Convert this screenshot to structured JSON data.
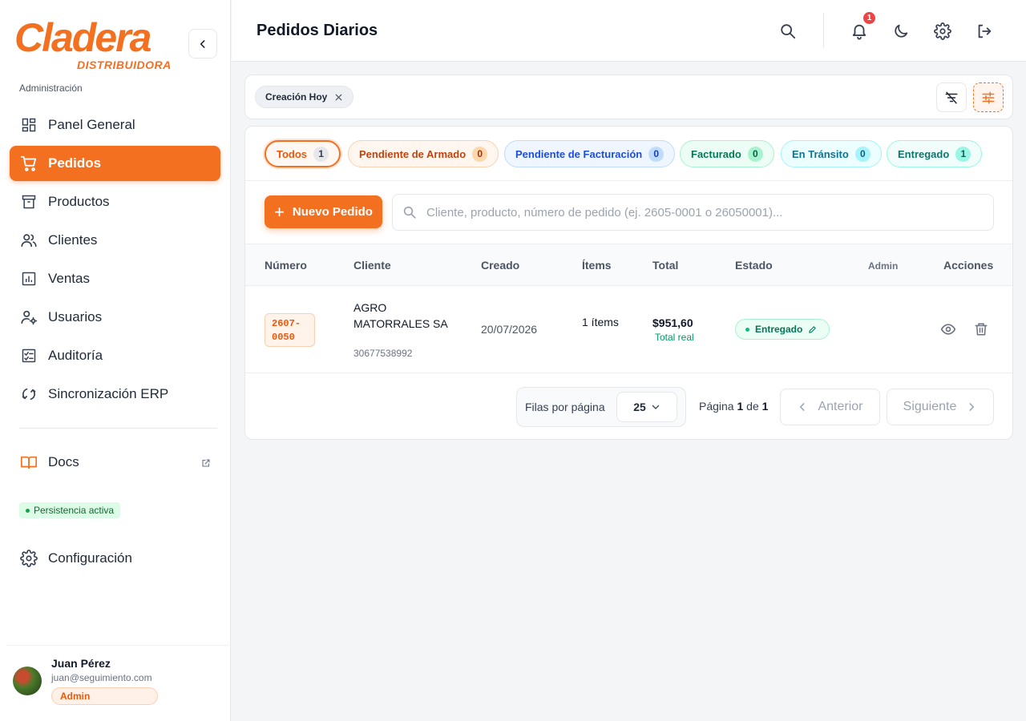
{
  "brand": {
    "logo_main": "Cladera",
    "logo_sub": "DISTRIBUIDORA",
    "section": "Administración"
  },
  "nav": {
    "items": [
      {
        "label": "Panel General",
        "icon": "dashboard-icon"
      },
      {
        "label": "Pedidos",
        "icon": "cart-icon",
        "active": true
      },
      {
        "label": "Productos",
        "icon": "archive-icon"
      },
      {
        "label": "Clientes",
        "icon": "users-icon"
      },
      {
        "label": "Ventas",
        "icon": "chart-icon"
      },
      {
        "label": "Usuarios",
        "icon": "user-settings-icon"
      },
      {
        "label": "Auditoría",
        "icon": "checklist-icon"
      },
      {
        "label": "Sincronización ERP",
        "icon": "sync-icon"
      }
    ],
    "docs": "Docs",
    "persistence": "Persistencia activa",
    "config": "Configuración"
  },
  "user": {
    "name": "Juan Pérez",
    "email": "juan@seguimiento.com",
    "role": "Admin"
  },
  "header": {
    "title": "Pedidos Diarios",
    "notification_count": "1"
  },
  "filters": {
    "active_chip": "Creación Hoy"
  },
  "tabs": [
    {
      "label": "Todos",
      "count": "1"
    },
    {
      "label": "Pendiente de Armado",
      "count": "0"
    },
    {
      "label": "Pendiente de Facturación",
      "count": "0"
    },
    {
      "label": "Facturado",
      "count": "0"
    },
    {
      "label": "En Tránsito",
      "count": "0"
    },
    {
      "label": "Entregado",
      "count": "1"
    }
  ],
  "toolbar": {
    "new_order_label": "Nuevo Pedido",
    "search_placeholder": "Cliente, producto, número de pedido (ej. 2605-0001 o 26050001)..."
  },
  "table": {
    "headers": {
      "numero": "Número",
      "cliente": "Cliente",
      "creado": "Creado",
      "items": "Ítems",
      "total": "Total",
      "estado": "Estado",
      "admin": "Admin",
      "acciones": "Acciones"
    },
    "rows": [
      {
        "numero_a": "2607-",
        "numero_b": "0050",
        "cliente": "AGRO MATORRALES SA",
        "cliente_id": "30677538992",
        "creado": "20/07/2026",
        "items": "1 ítems",
        "total": "$951,60",
        "total_sub": "Total real",
        "estado": "Entregado"
      }
    ]
  },
  "pagination": {
    "rows_label": "Filas por página",
    "rows_value": "25",
    "page_prefix": "Página",
    "page_current": "1",
    "page_of": "de",
    "page_total": "1",
    "prev": "Anterior",
    "next": "Siguiente"
  },
  "colors": {
    "brand": "#f37021",
    "success": "#047857",
    "danger": "#ef4444"
  }
}
